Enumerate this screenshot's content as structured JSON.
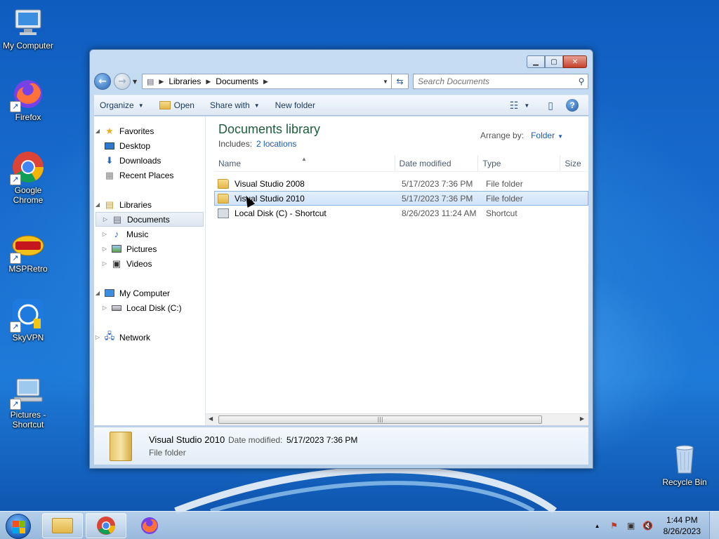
{
  "desktop": {
    "icons": [
      {
        "label": "My Computer"
      },
      {
        "label": "Firefox"
      },
      {
        "label": "Google Chrome"
      },
      {
        "label": "MSPRetro"
      },
      {
        "label": "SkyVPN"
      },
      {
        "label": "Pictures - Shortcut"
      },
      {
        "label": "Recycle Bin"
      }
    ]
  },
  "window": {
    "address": {
      "crumbs": [
        "Libraries",
        "Documents"
      ]
    },
    "search": {
      "placeholder": "Search Documents"
    },
    "toolbar": {
      "organize": "Organize",
      "open": "Open",
      "share_with": "Share with",
      "new_folder": "New folder"
    },
    "nav": {
      "favorites": "Favorites",
      "desktop": "Desktop",
      "downloads": "Downloads",
      "recent_places": "Recent Places",
      "libraries": "Libraries",
      "documents": "Documents",
      "music": "Music",
      "pictures": "Pictures",
      "videos": "Videos",
      "my_computer": "My Computer",
      "local_disk": "Local Disk (C:)",
      "network": "Network"
    },
    "library": {
      "title": "Documents library",
      "includes_label": "Includes:",
      "includes_link": "2 locations",
      "arrange_label": "Arrange by:",
      "arrange_value": "Folder"
    },
    "columns": {
      "name": "Name",
      "date": "Date modified",
      "type": "Type",
      "size": "Size"
    },
    "files": [
      {
        "name": "Visual Studio 2008",
        "date": "5/17/2023 7:36 PM",
        "type": "File folder"
      },
      {
        "name": "Visual Studio 2010",
        "date": "5/17/2023 7:36 PM",
        "type": "File folder"
      },
      {
        "name": "Local Disk (C) - Shortcut",
        "date": "8/26/2023 11:24 AM",
        "type": "Shortcut"
      }
    ],
    "details": {
      "name": "Visual Studio 2010",
      "modified_label": "Date modified:",
      "modified_value": "5/17/2023 7:36 PM",
      "type": "File folder"
    }
  },
  "taskbar": {
    "time": "1:44 PM",
    "date": "8/26/2023"
  },
  "colors": {
    "accent": "#1a5bb5",
    "library_title": "#1e5e3c",
    "selection": "#cfe3f8"
  }
}
